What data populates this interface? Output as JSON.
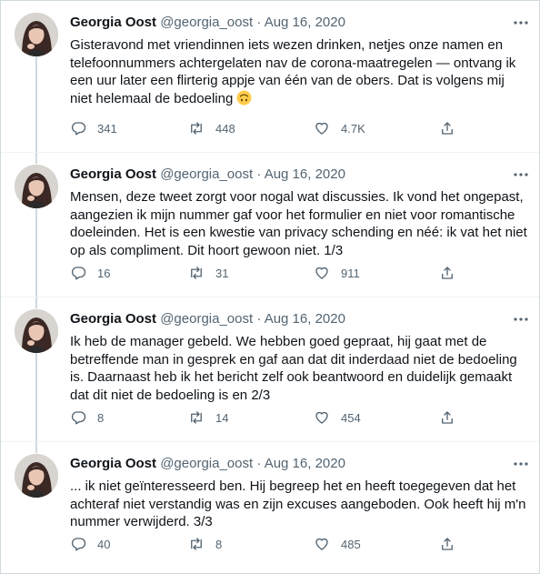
{
  "tweets": [
    {
      "name": "Georgia Oost",
      "handle": "@georgia_oost",
      "sep": "·",
      "date": "Aug 16, 2020",
      "text": "Gisteravond met vriendinnen iets wezen drinken, netjes onze namen en telefoonnummers achtergelaten nav de corona-maatregelen — ontvang ik een uur later een flirterig appje van één van de obers. Dat is volgens mij niet helemaal de bedoeling",
      "emoji": "upside-down-face-emoji",
      "replies": "341",
      "retweets": "448",
      "likes": "4.7K"
    },
    {
      "name": "Georgia Oost",
      "handle": "@georgia_oost",
      "sep": "·",
      "date": "Aug 16, 2020",
      "text": "Mensen, deze tweet zorgt voor nogal wat discussies. Ik vond het ongepast, aangezien ik mijn nummer gaf voor het formulier en niet voor romantische doeleinden. Het is een kwestie van privacy schending en néé: ik vat het niet op als compliment. Dit hoort gewoon niet. 1/3",
      "replies": "16",
      "retweets": "31",
      "likes": "911"
    },
    {
      "name": "Georgia Oost",
      "handle": "@georgia_oost",
      "sep": "·",
      "date": "Aug 16, 2020",
      "text": "Ik heb de manager gebeld. We hebben goed gepraat, hij gaat met de betreffende man in gesprek en gaf aan dat dit inderdaad niet de bedoeling is. Daarnaast heb ik het bericht zelf ook beantwoord en duidelijk gemaakt dat dit niet de bedoeling is en 2/3",
      "replies": "8",
      "retweets": "14",
      "likes": "454"
    },
    {
      "name": "Georgia Oost",
      "handle": "@georgia_oost",
      "sep": "·",
      "date": "Aug 16, 2020",
      "text": "... ik niet geïnteresseerd ben. Hij begreep het en heeft toegegeven dat het achteraf niet verstandig was en zijn excuses aangeboden. Ook heeft hij m'n nummer verwijderd. 3/3",
      "replies": "40",
      "retweets": "8",
      "likes": "485"
    }
  ],
  "icons": {
    "reply": "reply-icon",
    "retweet": "retweet-icon",
    "like": "like-icon",
    "share": "share-icon",
    "more": "more-icon"
  },
  "colors": {
    "text": "#0f1419",
    "secondary": "#536471",
    "thread_line": "#cfd9de",
    "divider": "#eff3f4"
  }
}
